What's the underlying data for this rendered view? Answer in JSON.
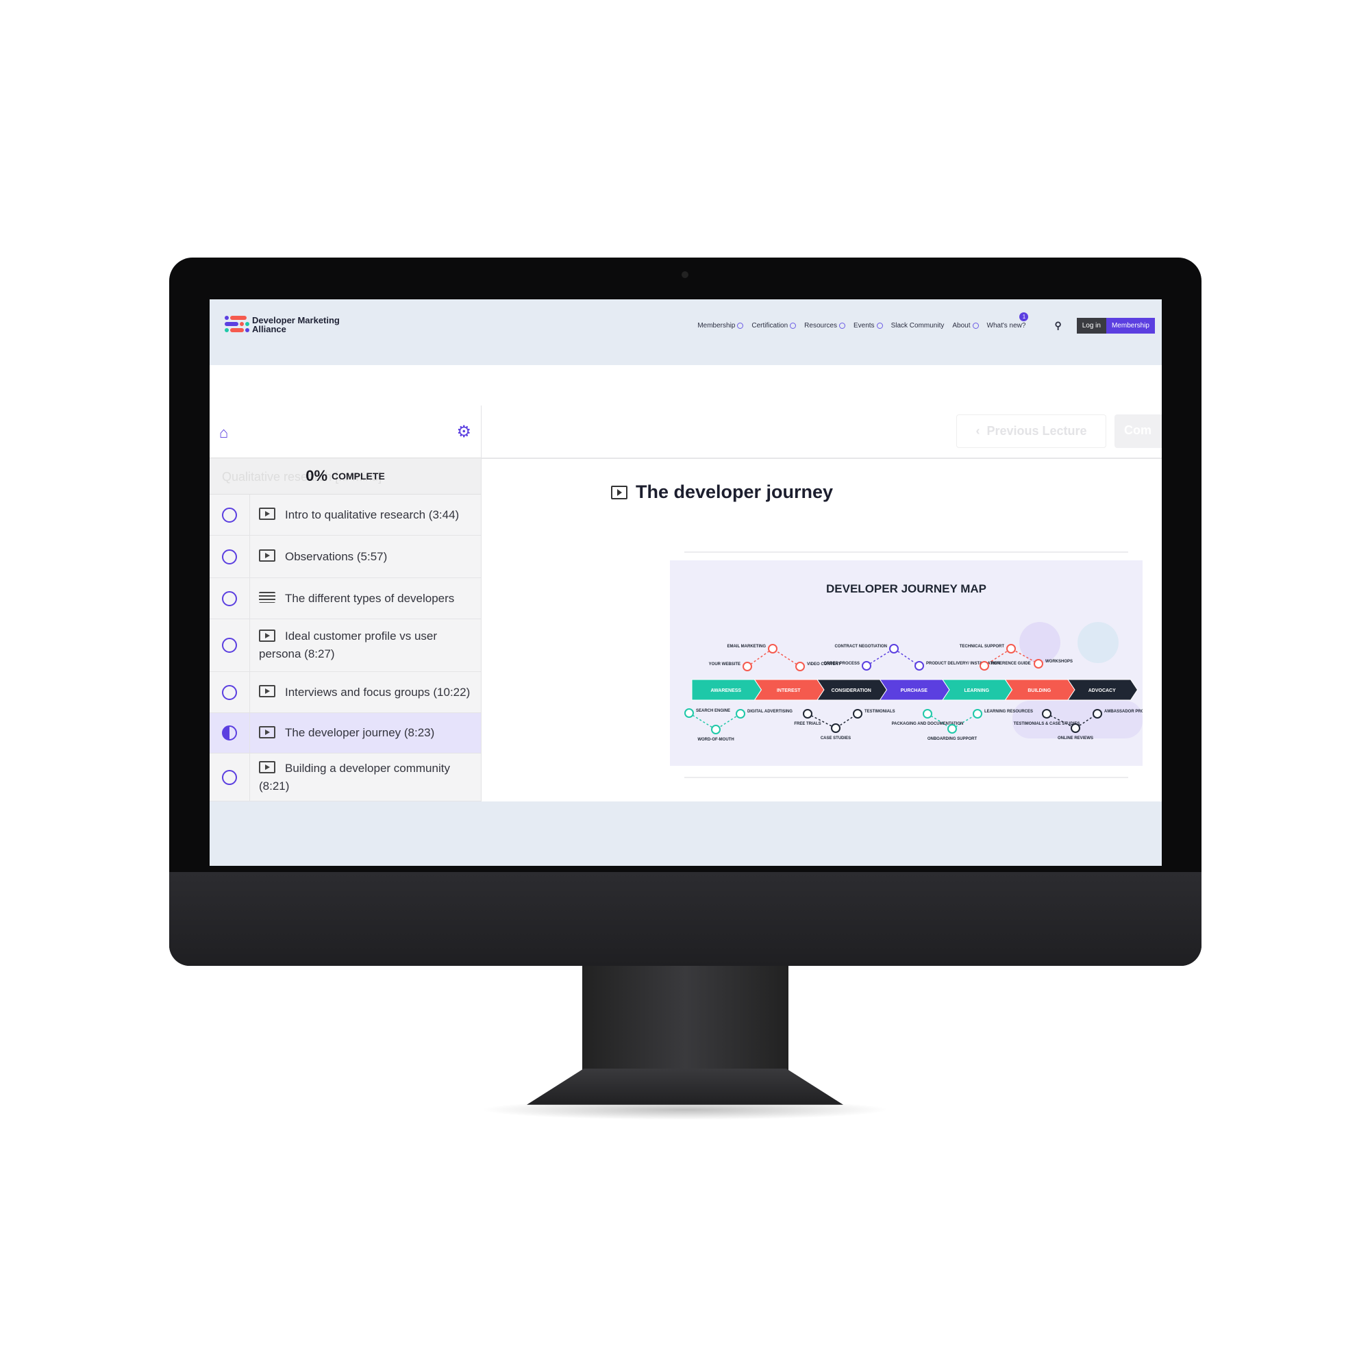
{
  "header": {
    "logo_text": "Developer Marketing Alliance",
    "nav": [
      {
        "label": "Membership",
        "dropdown": true
      },
      {
        "label": "Certification",
        "dropdown": true
      },
      {
        "label": "Resources",
        "dropdown": true
      },
      {
        "label": "Events",
        "dropdown": true
      },
      {
        "label": "Slack Community",
        "dropdown": false
      },
      {
        "label": "About",
        "dropdown": true
      },
      {
        "label": "What's new?",
        "dropdown": false,
        "badge": "1"
      }
    ],
    "login_label": "Log in",
    "membership_label": "Membership"
  },
  "sidebar": {
    "course_title_faded": "Qualitative research [... mins]",
    "progress_percent": "0%",
    "progress_label": "COMPLETE",
    "lessons": [
      {
        "label": "Intro to qualitative research (3:44)",
        "type": "video",
        "status": "not-started"
      },
      {
        "label": "Observations (5:57)",
        "type": "video",
        "status": "not-started"
      },
      {
        "label": "The different types of developers",
        "type": "text",
        "status": "not-started"
      },
      {
        "label": "Ideal customer profile vs user persona (8:27)",
        "type": "video",
        "status": "not-started"
      },
      {
        "label": "Interviews and focus groups (10:22)",
        "type": "video",
        "status": "not-started"
      },
      {
        "label": "The developer journey (8:23)",
        "type": "video",
        "status": "in-progress",
        "active": true
      },
      {
        "label": "Building a developer community (8:21)",
        "type": "video",
        "status": "not-started"
      }
    ]
  },
  "toolbar": {
    "previous_label": "Previous Lecture",
    "complete_label": "Com"
  },
  "lecture": {
    "title": "The developer journey"
  },
  "journey_map": {
    "title": "DEVELOPER JOURNEY MAP",
    "stages": [
      {
        "label": "AWARENESS",
        "color": "#1ec8a8"
      },
      {
        "label": "INTEREST",
        "color": "#f55a4e"
      },
      {
        "label": "CONSIDERATION",
        "color": "#1f2633"
      },
      {
        "label": "PURCHASE",
        "color": "#5b3fe0"
      },
      {
        "label": "LEARNING",
        "color": "#1ec8a8"
      },
      {
        "label": "BUILDING",
        "color": "#f55a4e"
      },
      {
        "label": "ADVOCACY",
        "color": "#1f2633"
      }
    ],
    "touchpoints": [
      "YOUR WEBSITE",
      "EMAIL MARKETING",
      "VIDEO CONTENT",
      "ORDER PROCESS",
      "CONTRACT NEGOTIATION",
      "PRODUCT DELIVERY/ INSTALLATION",
      "REFERENCE GUIDE",
      "TECHNICAL SUPPORT",
      "WORKSHOPS",
      "SEARCH ENGINE",
      "WORD-OF-MOUTH",
      "DIGITAL ADVERTISING",
      "FREE TRIALS",
      "CASE STUDIES",
      "TESTIMONIALS",
      "PACKAGING AND DOCUMENTATION",
      "ONBOARDING SUPPORT",
      "LEARNING RESOURCES",
      "TESTIMONIALS & CASE STUDIES",
      "ONLINE REVIEWS",
      "AMBASSADOR PROGRAM"
    ]
  }
}
